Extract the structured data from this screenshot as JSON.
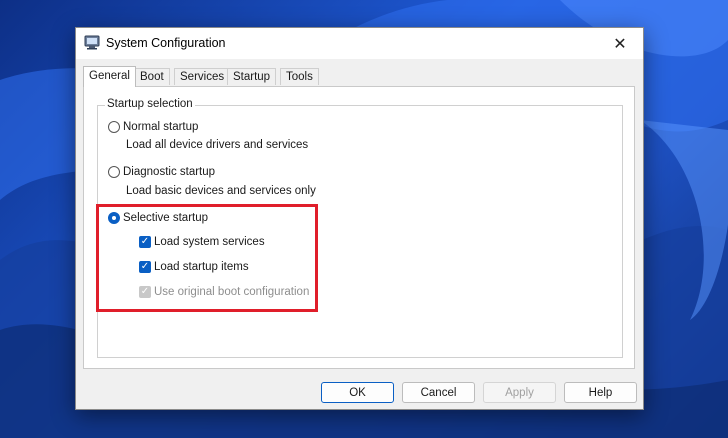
{
  "window": {
    "title": "System Configuration"
  },
  "tabs": [
    {
      "label": "General",
      "active": true
    },
    {
      "label": "Boot",
      "active": false
    },
    {
      "label": "Services",
      "active": false
    },
    {
      "label": "Startup",
      "active": false
    },
    {
      "label": "Tools",
      "active": false
    }
  ],
  "startup_selection": {
    "legend": "Startup selection",
    "normal": {
      "label": "Normal startup",
      "description": "Load all device drivers and services",
      "selected": false
    },
    "diagnostic": {
      "label": "Diagnostic startup",
      "description": "Load basic devices and services only",
      "selected": false
    },
    "selective": {
      "label": "Selective startup",
      "selected": true,
      "options": [
        {
          "label": "Load system services",
          "checked": true,
          "enabled": true
        },
        {
          "label": "Load startup items",
          "checked": true,
          "enabled": true
        },
        {
          "label": "Use original boot configuration",
          "checked": true,
          "enabled": false
        }
      ]
    }
  },
  "buttons": {
    "ok": "OK",
    "cancel": "Cancel",
    "apply": "Apply",
    "help": "Help"
  },
  "icons": {
    "close": "close-icon",
    "app": "system-configuration-icon"
  },
  "colors": {
    "accent": "#0a5fc4",
    "highlight": "#e01e2a"
  }
}
